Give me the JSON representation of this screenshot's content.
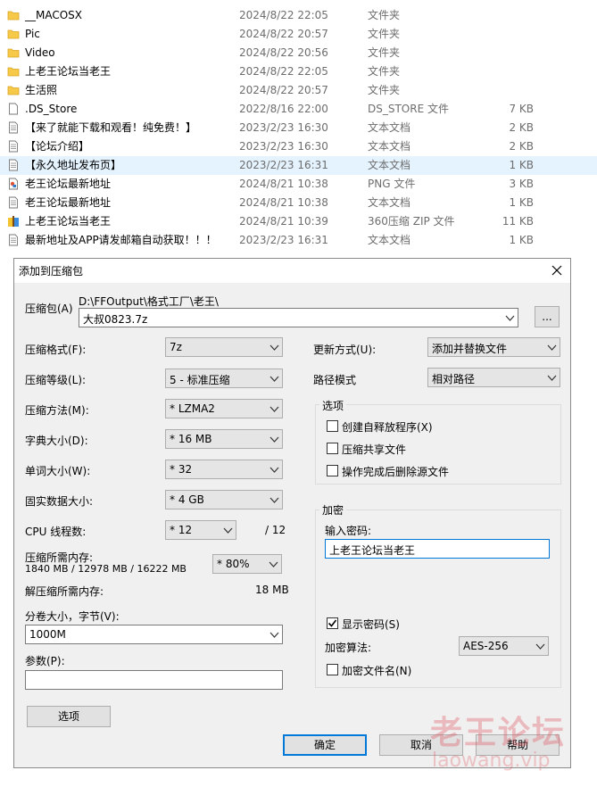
{
  "files": [
    {
      "name": "__MACOSX",
      "date": "2024/8/22 22:05",
      "type": "文件夹",
      "size": "",
      "icon": "folder-icon"
    },
    {
      "name": "Pic",
      "date": "2024/8/22 20:57",
      "type": "文件夹",
      "size": "",
      "icon": "folder-icon"
    },
    {
      "name": "Video",
      "date": "2024/8/22 20:56",
      "type": "文件夹",
      "size": "",
      "icon": "folder-icon"
    },
    {
      "name": "上老王论坛当老王",
      "date": "2024/8/22 22:05",
      "type": "文件夹",
      "size": "",
      "icon": "folder-icon"
    },
    {
      "name": "生活照",
      "date": "2024/8/22 20:57",
      "type": "文件夹",
      "size": "",
      "icon": "folder-icon"
    },
    {
      "name": ".DS_Store",
      "date": "2022/8/16 22:00",
      "type": "DS_STORE 文件",
      "size": "7 KB",
      "icon": "file-icon"
    },
    {
      "name": "【来了就能下载和观看！纯免费！】",
      "date": "2023/2/23 16:30",
      "type": "文本文档",
      "size": "2 KB",
      "icon": "text-file-icon"
    },
    {
      "name": "【论坛介绍】",
      "date": "2023/2/23 16:30",
      "type": "文本文档",
      "size": "2 KB",
      "icon": "text-file-icon"
    },
    {
      "name": "【永久地址发布页】",
      "date": "2023/2/23 16:31",
      "type": "文本文档",
      "size": "1 KB",
      "icon": "text-file-icon"
    },
    {
      "name": "老王论坛最新地址",
      "date": "2024/8/21 10:38",
      "type": "PNG 文件",
      "size": "3 KB",
      "icon": "image-file-icon"
    },
    {
      "name": "老王论坛最新地址",
      "date": "2024/8/21 10:38",
      "type": "文本文档",
      "size": "1 KB",
      "icon": "text-file-icon"
    },
    {
      "name": "上老王论坛当老王",
      "date": "2024/8/21 10:39",
      "type": "360压缩 ZIP 文件",
      "size": "11 KB",
      "icon": "zip-file-icon"
    },
    {
      "name": "最新地址及APP请发邮箱自动获取！！！",
      "date": "2023/2/23 16:31",
      "type": "文本文档",
      "size": "1 KB",
      "icon": "text-file-icon"
    }
  ],
  "dialog": {
    "title": "添加到压缩包",
    "archive_label": "压缩包(A)",
    "archive_path": "D:\\FFOutput\\格式工厂\\老王\\",
    "archive_name": "大叔0823.7z",
    "browse_label": "...",
    "left": {
      "format_label": "压缩格式(F):",
      "format_value": "7z",
      "level_label": "压缩等级(L):",
      "level_value": "5 - 标准压缩",
      "method_label": "压缩方法(M):",
      "method_value": "* LZMA2",
      "dict_label": "字典大小(D):",
      "dict_value": "* 16 MB",
      "word_label": "单词大小(W):",
      "word_value": "* 32",
      "solid_label": "固实数据大小:",
      "solid_value": "* 4 GB",
      "threads_label": "CPU 线程数:",
      "threads_value": "* 12",
      "threads_total": "/ 12",
      "mem_label": "压缩所需内存:",
      "mem_detail": "1840 MB / 12978 MB / 16222 MB",
      "mem_percent": "* 80%",
      "decomp_label": "解压缩所需内存:",
      "decomp_value": "18 MB",
      "split_label": "分卷大小，字节(V):",
      "split_value": "1000M",
      "params_label": "参数(P):",
      "params_value": "",
      "options_button": "选项"
    },
    "right": {
      "update_label": "更新方式(U):",
      "update_value": "添加并替换文件",
      "pathmode_label": "路径模式",
      "pathmode_value": "相对路径",
      "options_group": "选项",
      "opt_sfx": "创建自释放程序(X)",
      "opt_shared": "压缩共享文件",
      "opt_delete": "操作完成后删除源文件",
      "encrypt_group": "加密",
      "password_label": "输入密码:",
      "password_value": "上老王论坛当老王",
      "show_password": "显示密码(S)",
      "algo_label": "加密算法:",
      "algo_value": "AES-256",
      "encrypt_names": "加密文件名(N)"
    },
    "ok_button": "确定",
    "cancel_button": "取消",
    "help_button": "帮助"
  },
  "watermark": {
    "cn": "老王论坛",
    "en": "laowang.vip"
  },
  "colors": {
    "folder": "#f7c948",
    "selection": "#cce8ff",
    "accent": "#0078d7"
  }
}
